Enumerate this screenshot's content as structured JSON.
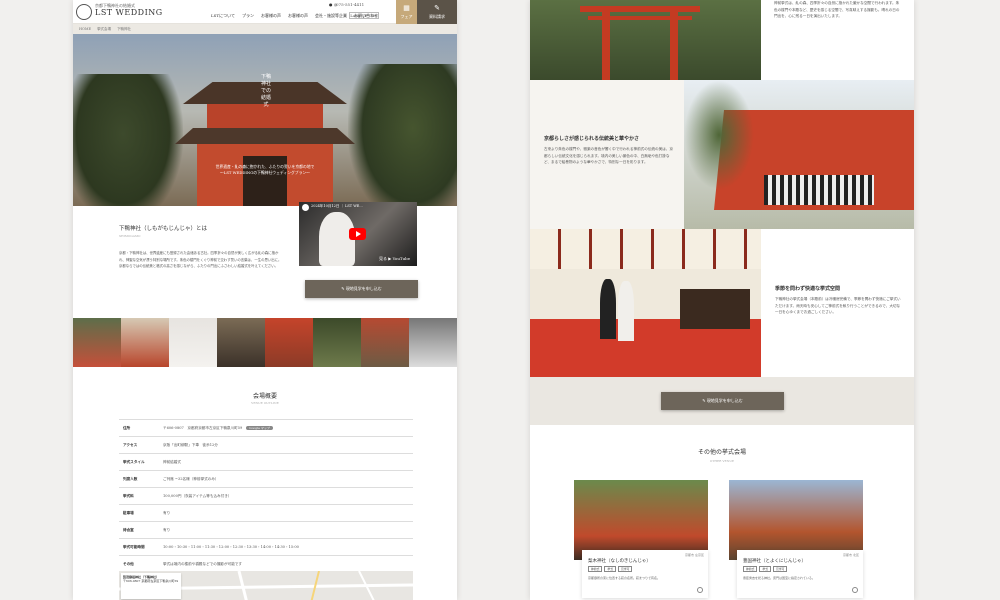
{
  "header": {
    "logo_sub": "京都下鴨神社の結婚式",
    "logo_main": "LST WEDDING",
    "tel": "075-551-4411",
    "lang_label": "Lang: JP / EN",
    "nav": [
      "LSTについて",
      "プラン",
      "お客様の声",
      "お客様の声",
      "会社・施設等企業",
      "お問い合わせ"
    ],
    "fair_label": "フェア",
    "request_label": "資料請求"
  },
  "breadcrumb": [
    "HOME",
    "挙式会場",
    "下鴨神社"
  ],
  "hero": {
    "title": "下鴨神社での結婚式",
    "copy_line1": "世界遺産・糺の森に抱かれた、ふたりの誓いを京都の地で",
    "copy_line2": "〜LST WEDDINGの下鴨神社ウェディングプラン〜"
  },
  "intro": {
    "heading": "下鴨神社（しもがもじんじゃ）とは",
    "sub": "SHIMOGAMO",
    "body": "京都・下鴨神社は、世界遺産にも登録された由緒ある古社。四季折々の自然が美しく広がる糺の森に抱かれ、神聖な空気が漂う特別な場所です。朱色の楼門をくぐり神前で交わす誓いの言葉は、一生の思い出に。京都ならではの伝統美と格式の高さを感じながら、ふたりの門出にふさわしい結婚式を叶えてください。"
  },
  "video": {
    "title": "2024年10月12日 ｜ LST WE...",
    "watch_on": "見る",
    "brand": "YouTube"
  },
  "cta_label": "現地見学を申し込む",
  "overview": {
    "title": "会場概要",
    "sub": "VENUE OUTLINE",
    "rows": [
      {
        "k": "住所",
        "v": "〒606-0807　京都府京都市左京区下鴨泉川町59",
        "tag": "Google マップ"
      },
      {
        "k": "アクセス",
        "v": "京阪「出町柳駅」下車　徒歩12分",
        "tag": ""
      },
      {
        "k": "挙式スタイル",
        "v": "神前結婚式",
        "tag": ""
      },
      {
        "k": "列席人数",
        "v": "ご列席 ~32名様（神前挙式のみ）",
        "tag": ""
      },
      {
        "k": "挙式料",
        "v": "100,000円（衣装アイテム等も込み付き）",
        "tag": ""
      },
      {
        "k": "駐車場",
        "v": "有り",
        "tag": ""
      },
      {
        "k": "待合室",
        "v": "有り",
        "tag": ""
      },
      {
        "k": "挙式可能時間",
        "v": "10:00・10:30・11:00・11:30・12:00・12:30・13:30・14:00・14:30・15:00",
        "tag": ""
      },
      {
        "k": "その他",
        "v": "挙式は境内の楼前や橋殿などでの撮影が可能です",
        "tag": ""
      }
    ]
  },
  "map": {
    "title": "賀茂御祖神社（下鴨神社）",
    "detail": "〒606-0807 京都府左京区下鴨泉川町59"
  },
  "right_sections": [
    {
      "heading": "",
      "body": "神前挙式は、糺の森、四季折々の自然に抱かれた厳かな空間で行われます。朱色の楼門や本殿など、歴史を感じる空間で、写真映えする撮影も。晴れの日の門出を、心に残る一日を演出いたします。"
    },
    {
      "heading": "京都らしさが感じられる伝統美と華やかさ",
      "body": "古来より朱色の楼門や、雅楽の音色が響く中で行われる神前式の伝統の美は、京都らしい伝統文化を感じられます。境内の美しい景色の中、白無垢や色打掛など、まるで絵巻物のような華やかさで、特別な一日を彩ります。"
    },
    {
      "heading": "季節を問わず快適な挙式空間",
      "body": "下鴨神社の挙式会場（本殿前）は冷暖房完備で、季節を問わず快適にご挙式いただけます。雨天時も安心してご神前式を執り行うことができるので、大切な一日を心ゆくまでお過ごしください。"
    }
  ],
  "other": {
    "title": "その他の挙式会場",
    "sub": "OTHER VENUE",
    "cards": [
      {
        "area": "京都市 左京区",
        "name": "梨木神社（なしのきじんじゃ）",
        "tags": [
          "神前式",
          "挙式",
          "見学可"
        ],
        "desc": "京都御所の東に位置する萩の名所。萩まつりで有名。"
      },
      {
        "area": "京都市 北区",
        "name": "豊国神社（とよくにじんじゃ）",
        "tags": [
          "神前式",
          "挙式",
          "見学可"
        ],
        "desc": "豊臣秀吉を祀る神社。唐門は国宝に指定されている。"
      }
    ]
  },
  "colors": {
    "accent": "#6d655a",
    "gold": "#c6a97a",
    "torii": "#c43b22"
  }
}
